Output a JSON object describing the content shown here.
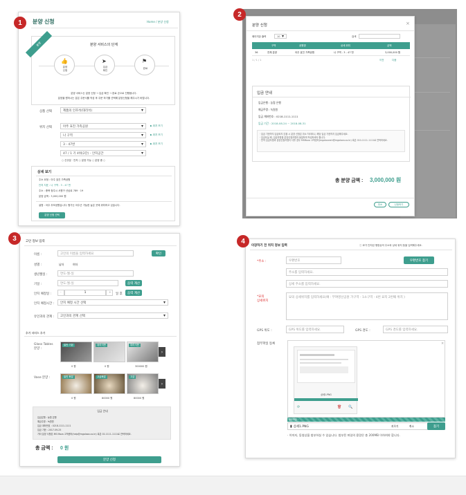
{
  "badges": [
    "1",
    "2",
    "3",
    "4"
  ],
  "p1": {
    "title": "분양 신청",
    "breadcrumb": "Home / 분양 신청",
    "ribbon": "분양",
    "steps_title": "분양 서비스의 단계",
    "steps": [
      {
        "label": "분양\n신청",
        "icon": "thumbs-up-icon"
      },
      {
        "label": "입금\n확인",
        "icon": "send-icon"
      },
      {
        "label": "완료",
        "icon": "flag-icon"
      }
    ],
    "desc1": "분양 서비스는 분양 신청 → 입금 확인 → 완료 순으로 진행됩니다.",
    "desc2": "분양을 원하시는 분은 주문서를 작성 후 주문 하기를 선택해 분양신청을 해주시기 바랍니다.",
    "field_product": "상품 선택",
    "product_value": "제품의 인조석(대리석)",
    "field_location": "위치 선택",
    "loc_values": [
      "아주 효진 가족공원",
      "나 구역",
      "3 - 47번",
      "47 / 1 기 4위(2단) - 안치공간"
    ],
    "loc_link": "▶ 위치 보기",
    "legend": "○ 신규분 · 안치 ○ 분양 가능 ○ 분양 중 ○",
    "detail_title": "상세 보기",
    "detail_lines": [
      "주소 요청 : 아주 효진 가족공원",
      "안치 지표 : 나 구역 . 3 - 47 번",
      "주소 : 충북 청주시 서원구 산남로 789 · 19",
      "분양 금액 : 3,000,000 원"
    ],
    "detail_note": "설명 : 아주 추모공원입니다. 평가는 아주군 가능한 높은 곳에 위치하고 있습니다.",
    "apply_btn": "분양 신청 선택"
  },
  "p2": {
    "title": "분양 신청",
    "close": "×",
    "per_page_label": "페이지당 출력",
    "per_page": "10",
    "search_label": "검색",
    "columns": [
      "구역",
      "공원명",
      "상세 위치",
      "금액"
    ],
    "row": [
      "전체 분양",
      "아주 효진 가족공원",
      "나 구역 - 3 - 47 번",
      "3,000,000 원"
    ],
    "row_num": "36",
    "count": "1 / 1 / 1",
    "pager": [
      "이전",
      "다음"
    ],
    "bank_title": "입금 안내",
    "bank_lines": [
      "입금은행 : 농협 은행",
      "예금주명 : 녹원원",
      "입금 계좌번호 : 0218-1111-1111",
      "입금 기간 : 2018-08-24 ~ 2018-08-31"
    ],
    "notes": "· 입금 기한까지 입금되지 않을 시 분양 신청은 취소 처리되니, 해당 입금 기한까지 입금해주세요.\n· 입금되실 때, 입금자명을 분양신청자명과 동일하게 작성하셔야 합니다.\n· 만약 입금자명과 분양신청자명이 다를 경우 MSMaza 고객센터(mgalaxcent@mgalaxa.co.kr) 혹은 010-1111-1111로 연락하세요.",
    "total_label": "총 분양 금액 :",
    "total_value": "3,000,000 원",
    "cancel": "취소",
    "apply": "신청하기"
  },
  "p3": {
    "section": "고인 정보 입력",
    "name_label": "이름 :",
    "name_placeholder": "고인의 이름을 입력하세요",
    "name_btn": "확인",
    "gender_label": "성별 :",
    "gender_opts": [
      "남자",
      "여자"
    ],
    "birth_label": "생년월일 :",
    "birth_ph": "연도-월-일",
    "death_label": "기일 :",
    "death_ph": "연도-월-일",
    "death_btn": "음력 계산",
    "period_label": "안치 예정일 :",
    "period_value": "1",
    "period_unit": "일 후",
    "period_btn": "음력 계산",
    "religion_label": "안치 예정시간 :",
    "religion_value": "안치 예정 시간 선택",
    "relation_label": "유인과의 관계 :",
    "relation_value": "고인과의 관계 선택",
    "extra_title": "추가 서비스 추가",
    "deco_label": "Glass Tables\n분양 :",
    "deco_items": [
      {
        "tag": "일반 기본",
        "price": "0 원"
      },
      {
        "tag": "대리석판",
        "price": "0 원"
      },
      {
        "tag": "대리석판",
        "price": "300000 원"
      }
    ],
    "vase_label": "Vase 분양 :",
    "vase_items": [
      {
        "tag": "일반 화분",
        "price": "0 원"
      },
      {
        "tag": "고급화분",
        "price": "80000 원"
      },
      {
        "tag": "고급",
        "price": "80000 원"
      }
    ],
    "bank_title": "입금 안내",
    "bank_lines": [
      "입금은행 : 농협 은행",
      "예금주명 : 녹원원",
      "입금 계좌번호 : 0218-1111-1111",
      "입금 기한 : 2017-09-25",
      "기타 분양 사항은 MS Maza 고객센터(help@mgalaxa.co.kr) 혹은 02-1111-1111로 연락하세요."
    ],
    "total_label": "총 금액 :",
    "total_value": "0 원",
    "submit": "분양 신청"
  },
  "p4": {
    "section": "이장하기 전 위치 정보 입력",
    "hint": "ⓘ 묘가 안치된 행정상의 주소와 상세 위치 등을 입력해주세요.",
    "addr_label": "*주소 :",
    "zip_ph": "우편번호",
    "zip_btn": "우편번호 찾기",
    "addr_ph": "주소를 입력하세요.",
    "addr2_ph": "상세 주소를 입력하세요.",
    "detail_label": "*묘의\n상세위치",
    "detail_ph": "묘의 상세위치를 입력하세요(예 : 부여영산공원 가구역 - 1소구역 - 4번 묘지 2번째 위치 )",
    "lat_label": "GPS 위도 :",
    "lat_ph": "GPS 위도를 입력하세요.",
    "lng_label": "GPS 경도 :",
    "lng_ph": "GPS 경도를 입력하세요.",
    "file_label": "첨부파일 등록",
    "preview_caption": "상세1.PNG",
    "file_bar": "첨부파일 :",
    "file_name": "상세1.PNG",
    "file_actions": [
      "지우기",
      "취소",
      "찾기"
    ],
    "file_note": "· 이미지, 동영상을 첨부하실 수 있습니다. 첨부된 파일의 용량은 총 200MB 이하여야 합니다."
  },
  "colors": {
    "accent": "#3e9e8e",
    "badge": "#c62828"
  }
}
